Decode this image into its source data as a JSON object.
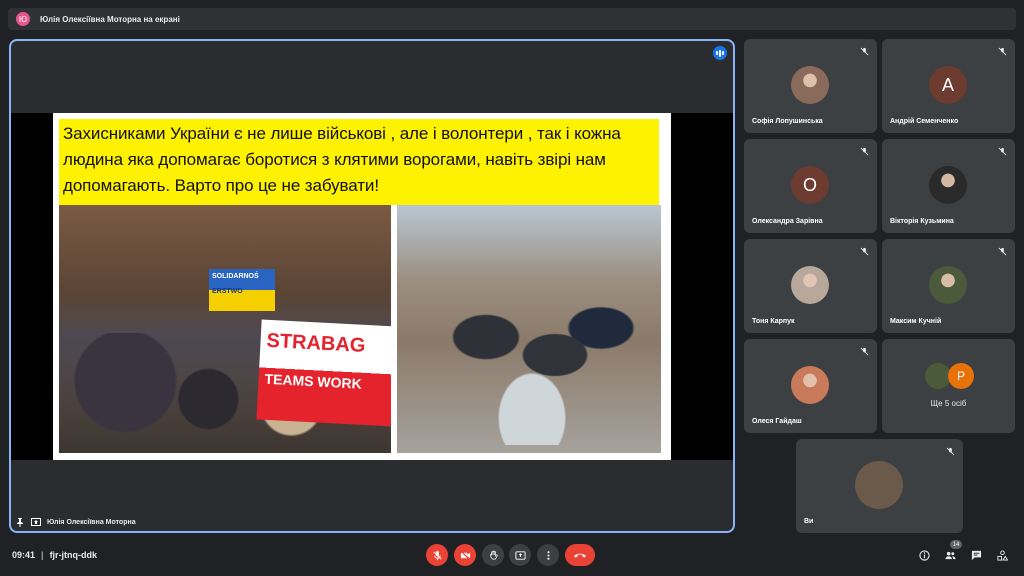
{
  "banner": {
    "avatar_letter": "Ю",
    "text": "Юлія Олексіївна Моторна на екрані"
  },
  "presentation": {
    "slide_text": "Захисниками України є не лише військові , але і волонтери , так і  кожна людина яка допомагає боротися з клятими ворогами, навіть звірі нам допомагають. Варто про це не забувати!",
    "flag_line1": "SOLIDARNOŚ",
    "flag_line2": "ERSTWO",
    "banner_line1": "STRABAG",
    "banner_line2": "TEAMS WORK",
    "presenter_name": "Юлія Олексіївна Моторна"
  },
  "participants": [
    {
      "name": "Софія Лопушинська",
      "avatar": "photo",
      "color": "#8a6a5a"
    },
    {
      "name": "Андрій Семенченко",
      "avatar": "A",
      "color": "#6d3b30"
    },
    {
      "name": "Олександра Зарівна",
      "avatar": "О",
      "color": "#6d3b30"
    },
    {
      "name": "Вікторія Кузьмина",
      "avatar": "photo",
      "color": "#2a2a2a"
    },
    {
      "name": "Тоня Карпук",
      "avatar": "photo",
      "color": "#b8a79b"
    },
    {
      "name": "Максим Кучній",
      "avatar": "photo",
      "color": "#4a5a3a"
    },
    {
      "name": "Олеся Гайдаш",
      "avatar": "photo",
      "color": "#c87a5a"
    }
  ],
  "more_tile": {
    "avatar_letter": "Р",
    "label": "Ще 5 осіб",
    "color": "#e8710a"
  },
  "self_tile": {
    "name": "Ви"
  },
  "footer": {
    "time": "09:41",
    "meeting_code": "fjr-jtnq-ddk",
    "participants_count": "14"
  },
  "colors": {
    "accent": "#8ab4f8",
    "danger": "#ea4335",
    "surface": "#3c4043"
  }
}
